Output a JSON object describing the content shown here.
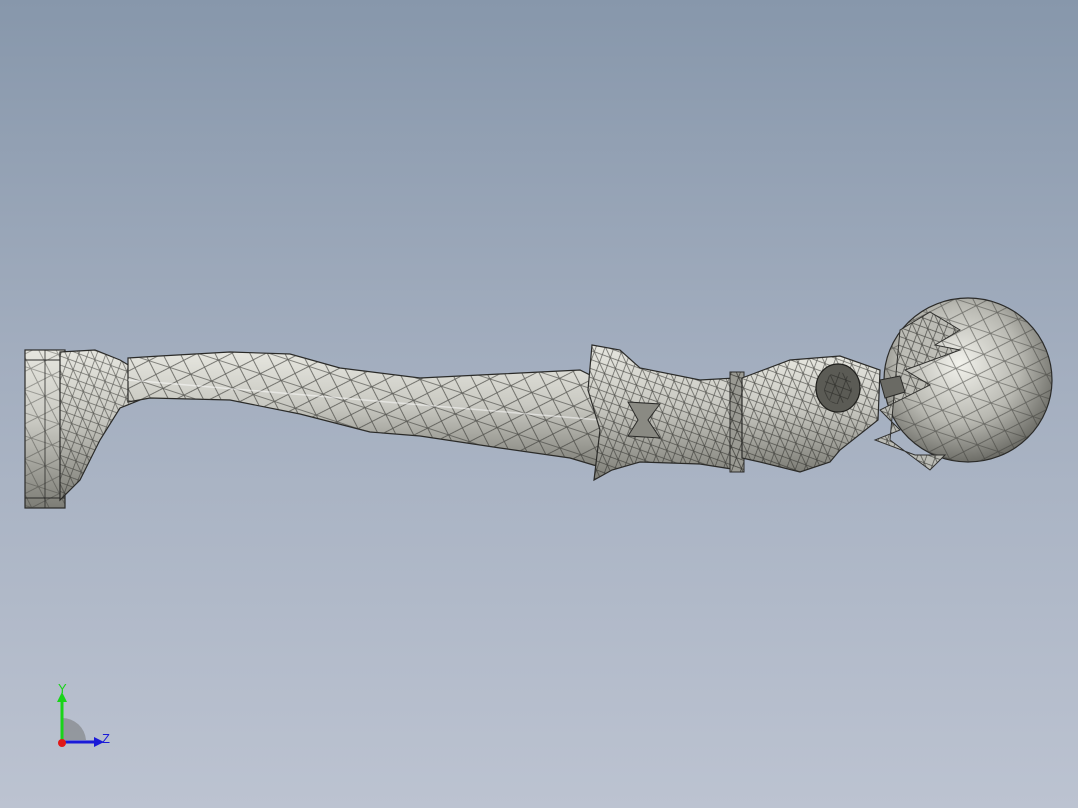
{
  "viewport": {
    "background_top": "#8797ab",
    "background_bottom": "#bcc3d1"
  },
  "model": {
    "render_style": "shaded-with-edges",
    "surface_color": "#c9c9c2",
    "edge_color": "#2a2a28"
  },
  "triad": {
    "y_label": "Y",
    "z_label": "Z",
    "y_color": "#19d419",
    "z_color": "#1a1ad8",
    "x_color": "#e01818"
  }
}
